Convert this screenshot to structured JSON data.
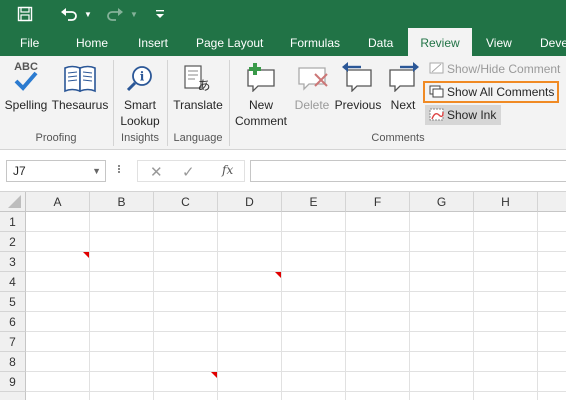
{
  "qat": {
    "save_icon": "save-icon",
    "undo_icon": "undo-icon",
    "redo_icon": "redo-icon",
    "customize_icon": "customize-qat-icon"
  },
  "tabs": [
    {
      "label": "File"
    },
    {
      "label": "Home"
    },
    {
      "label": "Insert"
    },
    {
      "label": "Page Layout"
    },
    {
      "label": "Formulas"
    },
    {
      "label": "Data"
    },
    {
      "label": "Review"
    },
    {
      "label": "View"
    },
    {
      "label": "Deve"
    }
  ],
  "active_tab": "Review",
  "ribbon": {
    "proofing": {
      "label": "Proofing",
      "spelling": "Spelling",
      "spelling_abc": "ABC",
      "thesaurus": "Thesaurus"
    },
    "insights": {
      "label": "Insights",
      "smart_lookup_1": "Smart",
      "smart_lookup_2": "Lookup"
    },
    "language": {
      "label": "Language",
      "translate": "Translate"
    },
    "comments": {
      "label": "Comments",
      "new_comment_1": "New",
      "new_comment_2": "Comment",
      "delete": "Delete",
      "previous": "Previous",
      "next": "Next",
      "show_hide": "Show/Hide Comment",
      "show_all": "Show All Comments",
      "show_ink": "Show Ink"
    }
  },
  "formula_bar": {
    "name_box": "J7",
    "fx": "fx",
    "formula": ""
  },
  "sheet": {
    "columns": [
      "A",
      "B",
      "C",
      "D",
      "E",
      "F",
      "G",
      "H"
    ],
    "rows": [
      "1",
      "2",
      "3",
      "4",
      "5",
      "6",
      "7",
      "8",
      "9"
    ]
  },
  "colors": {
    "accent": "#217346",
    "highlight_border": "#f08a24",
    "comment_indicator": "#e00000"
  }
}
